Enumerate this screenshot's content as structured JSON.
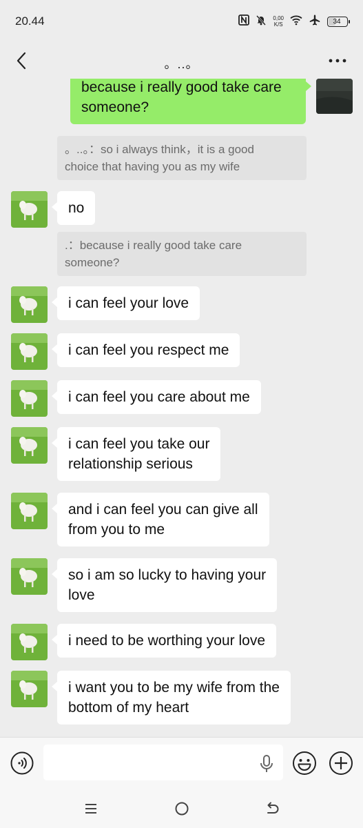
{
  "status_bar": {
    "time": "20.44",
    "net_speed_value": "0,00",
    "net_speed_unit": "K/S",
    "battery": "34",
    "battery_level_percent": 34,
    "icons": [
      "nfc-icon",
      "mute-icon",
      "wifi-icon",
      "airplane-icon",
      "battery-icon"
    ]
  },
  "header": {
    "title": "。..。",
    "back_icon": "chevron-left-icon",
    "more_icon": "more-dots-icon"
  },
  "messages": [
    {
      "side": "right",
      "type": "text",
      "text": "because i really good take care\nsomeone?"
    },
    {
      "side": "left",
      "type": "quote",
      "text": "。..。：so i always think，it is a good\nchoice that having you as my wife"
    },
    {
      "side": "left",
      "type": "text",
      "text": "no"
    },
    {
      "side": "left",
      "type": "quote",
      "text": ".：because i really good take care\nsomeone?"
    },
    {
      "side": "left",
      "type": "text",
      "text": "i can feel your love"
    },
    {
      "side": "left",
      "type": "text",
      "text": "i can feel you respect me"
    },
    {
      "side": "left",
      "type": "text",
      "text": "i can feel you care about me"
    },
    {
      "side": "left",
      "type": "text",
      "text": "i can feel you take our\nrelationship serious"
    },
    {
      "side": "left",
      "type": "text",
      "text": "and i can feel you can give all\nfrom you to me"
    },
    {
      "side": "left",
      "type": "text",
      "text": "so i am so lucky to having your\nlove"
    },
    {
      "side": "left",
      "type": "text",
      "text": "i need to be worthing your love"
    },
    {
      "side": "left",
      "type": "text",
      "text": "i want you to be my wife from the\nbottom of my heart"
    }
  ],
  "input_bar": {
    "value": "",
    "icons": [
      "voice-icon",
      "mic-icon",
      "emoji-icon",
      "plus-icon"
    ]
  },
  "nav_bar": {
    "icons": [
      "menu-icon",
      "home-icon",
      "back-icon"
    ]
  },
  "colors": {
    "background": "#ededed",
    "sent_bubble": "#95ec69",
    "received_bubble": "#ffffff",
    "quote_bg": "#e2e2e2"
  }
}
